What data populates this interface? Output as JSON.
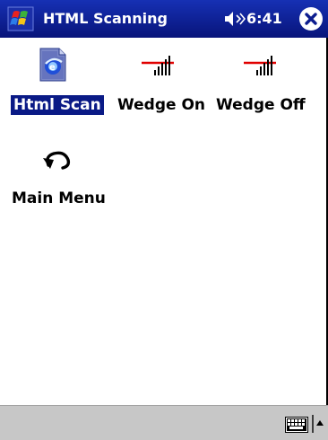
{
  "titlebar": {
    "app_title": "HTML Scanning",
    "clock": "6:41",
    "start_icon": "windows-flag-icon",
    "speaker_icon": "speaker-icon",
    "close_icon": "close-icon"
  },
  "tiles": [
    {
      "label": "Html Scan",
      "icon": "html-document-icon",
      "selected": true
    },
    {
      "label": "Wedge On",
      "icon": "wedge-on-icon",
      "selected": false
    },
    {
      "label": "Wedge Off",
      "icon": "wedge-off-icon",
      "selected": false
    },
    {
      "label": "Main Menu",
      "icon": "back-arrow-icon",
      "selected": false
    }
  ],
  "menubar": {
    "sip_icon": "keyboard-icon",
    "sip_arrow_icon": "sip-up-arrow-icon"
  },
  "colors": {
    "titlebar": "#0c1c8e",
    "selection": "#0a1a86",
    "menubar": "#c7c7c7",
    "wedge_red": "#e00000"
  }
}
